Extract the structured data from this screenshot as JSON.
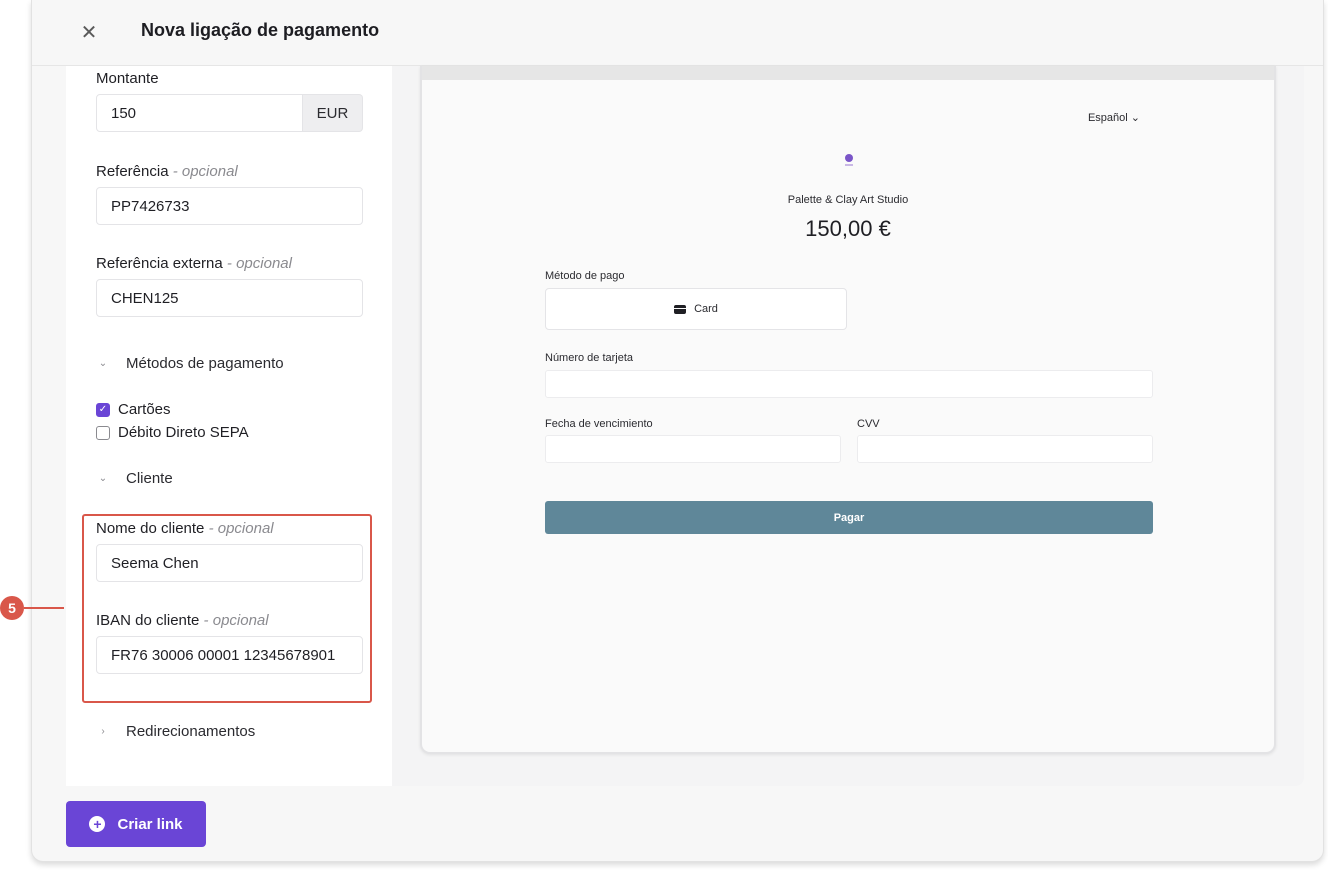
{
  "header": {
    "title": "Nova ligação de pagamento",
    "close_icon": "close-icon"
  },
  "form": {
    "amount": {
      "label": "Montante",
      "value": "150",
      "currency": "EUR"
    },
    "reference": {
      "label": "Referência",
      "optional": " - opcional",
      "value": "PP7426733"
    },
    "external_reference": {
      "label": "Referência externa",
      "optional": " - opcional",
      "value": "CHEN125"
    },
    "payment_methods": {
      "title": "Métodos de pagamento",
      "options": [
        {
          "label": "Cartões",
          "checked": true
        },
        {
          "label": "Débito Direto SEPA",
          "checked": false
        }
      ]
    },
    "customer": {
      "title": "Cliente",
      "name": {
        "label": "Nome do cliente",
        "optional": " - opcional",
        "value": "Seema Chen"
      },
      "iban": {
        "label": "IBAN do cliente",
        "optional": " - opcional",
        "value": "FR76 30006 00001 12345678901"
      }
    },
    "redirects": {
      "title": "Redirecionamentos"
    }
  },
  "annotation": {
    "step": "5",
    "color": "#d9574a"
  },
  "preview": {
    "language": "Español",
    "merchant": "Palette & Clay Art Studio",
    "amount": "150,00 €",
    "payment_method_label": "Método de pago",
    "card_tab": "Card",
    "card_number_label": "Número de tarjeta",
    "expiry_label": "Fecha de vencimiento",
    "cvv_label": "CVV",
    "pay_button": "Pagar"
  },
  "footer": {
    "create_button": "Criar link"
  },
  "colors": {
    "accent": "#6a45d6",
    "pay_button": "#5f8799",
    "highlight": "#d9574a"
  }
}
